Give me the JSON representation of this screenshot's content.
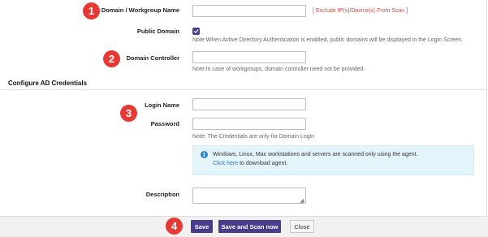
{
  "steps": [
    "1",
    "2",
    "3",
    "4"
  ],
  "form": {
    "domain_label": "Domain / Workgroup Name",
    "domain_required_mark": "*",
    "domain_value": "",
    "exclude_link": "[ Exclude IP(s)/Device(s) From Scan ]",
    "public_domain_label": "Public Domain",
    "public_domain_checked": true,
    "public_domain_note": "Note:When Active Directory Authentication is enabled, public domains will be displayed in the Login Screen.",
    "domain_controller_label": "Domain Controller",
    "domain_controller_value": "",
    "domain_controller_note": "Note:In case of workgroups, domain controller need not be provided."
  },
  "credentials": {
    "section_title": "Configure AD Credentials",
    "login_label": "Login Name",
    "login_value": "",
    "password_label": "Password",
    "password_value": "",
    "password_note": "Note: The Credentials are only for Domain Login"
  },
  "info_box": {
    "icon": "info-icon",
    "message": "Windows, Linux, Mac workstations and servers are scanned only using the agent.",
    "link_text": "Click here",
    "link_suffix": " to download agent."
  },
  "description": {
    "label": "Description",
    "value": ""
  },
  "buttons": {
    "save": "Save",
    "save_scan": "Save and Scan now",
    "close": "Close"
  },
  "colors": {
    "primary": "#4a3c8c",
    "badge": "#e53935",
    "required": "#d9534f",
    "info_bg": "#e4f4fb",
    "link": "#2b7bc0"
  }
}
